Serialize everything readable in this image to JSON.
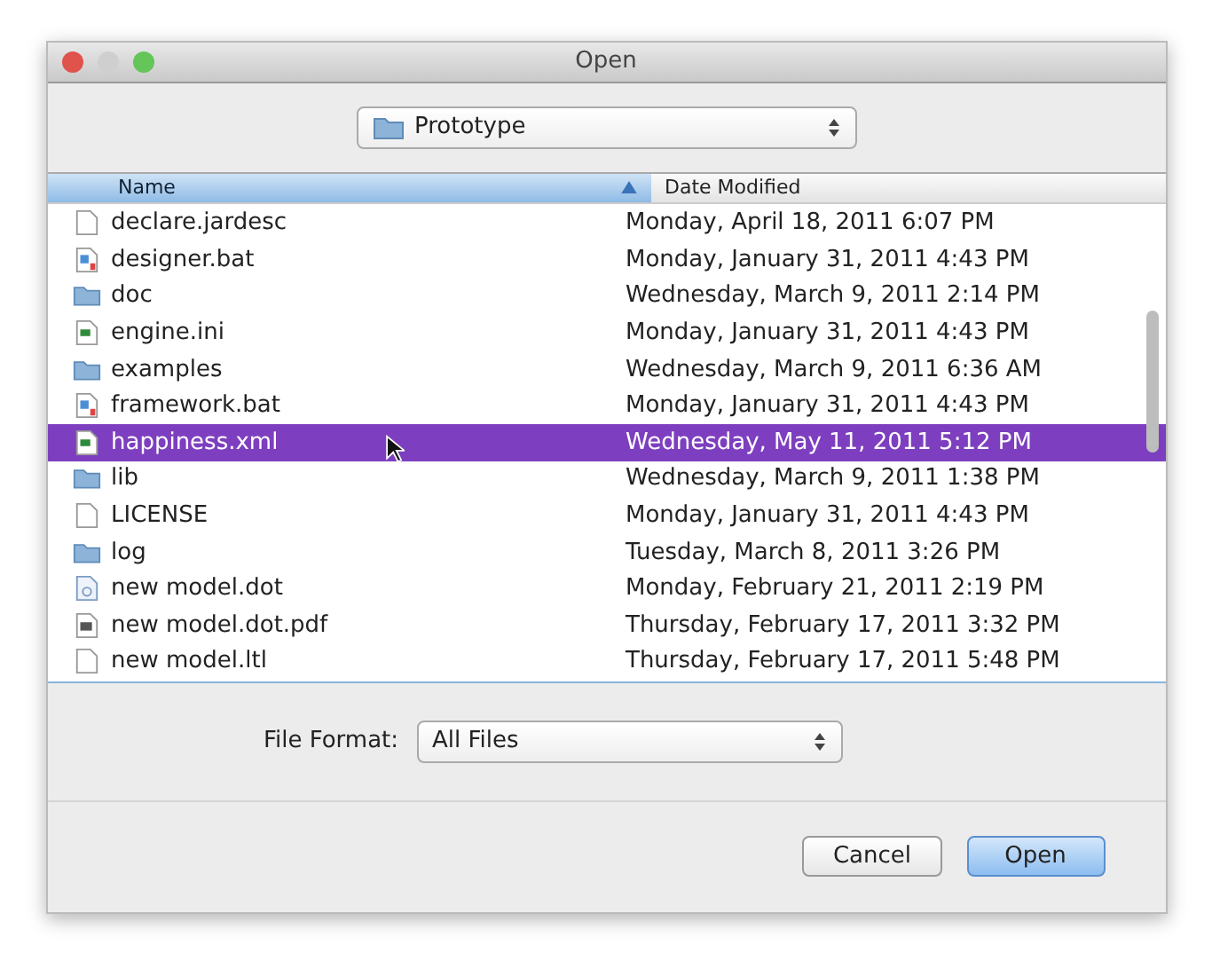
{
  "window": {
    "title": "Open"
  },
  "location": {
    "label": "Prototype"
  },
  "table": {
    "columns": [
      {
        "label": "Name",
        "sorted": true
      },
      {
        "label": "Date Modified",
        "sorted": false
      }
    ],
    "rows": [
      {
        "name": "declare.jardesc",
        "date": "Monday, April 18, 2011 6:07 PM",
        "kind": "file",
        "selected": false
      },
      {
        "name": "designer.bat",
        "date": "Monday, January 31, 2011 4:43 PM",
        "kind": "script",
        "selected": false
      },
      {
        "name": "doc",
        "date": "Wednesday, March 9, 2011 2:14 PM",
        "kind": "folder",
        "selected": false
      },
      {
        "name": "engine.ini",
        "date": "Monday, January 31, 2011 4:43 PM",
        "kind": "config",
        "selected": false
      },
      {
        "name": "examples",
        "date": "Wednesday, March 9, 2011 6:36 AM",
        "kind": "folder",
        "selected": false
      },
      {
        "name": "framework.bat",
        "date": "Monday, January 31, 2011 4:43 PM",
        "kind": "script",
        "selected": false
      },
      {
        "name": "happiness.xml",
        "date": "Wednesday, May 11, 2011 5:12 PM",
        "kind": "config",
        "selected": true
      },
      {
        "name": "lib",
        "date": "Wednesday, March 9, 2011 1:38 PM",
        "kind": "folder",
        "selected": false
      },
      {
        "name": "LICENSE",
        "date": "Monday, January 31, 2011 4:43 PM",
        "kind": "file",
        "selected": false
      },
      {
        "name": "log",
        "date": "Tuesday, March 8, 2011 3:26 PM",
        "kind": "folder",
        "selected": false
      },
      {
        "name": "new model.dot",
        "date": "Monday, February 21, 2011 2:19 PM",
        "kind": "text",
        "selected": false
      },
      {
        "name": "new model.dot.pdf",
        "date": "Thursday, February 17, 2011 3:32 PM",
        "kind": "pdf",
        "selected": false
      },
      {
        "name": "new model.ltl",
        "date": "Thursday, February 17, 2011 5:48 PM",
        "kind": "file",
        "selected": false
      }
    ]
  },
  "format": {
    "label": "File Format:",
    "value": "All Files"
  },
  "buttons": [
    {
      "label": "Cancel",
      "default": false
    },
    {
      "label": "Open",
      "default": true
    }
  ]
}
